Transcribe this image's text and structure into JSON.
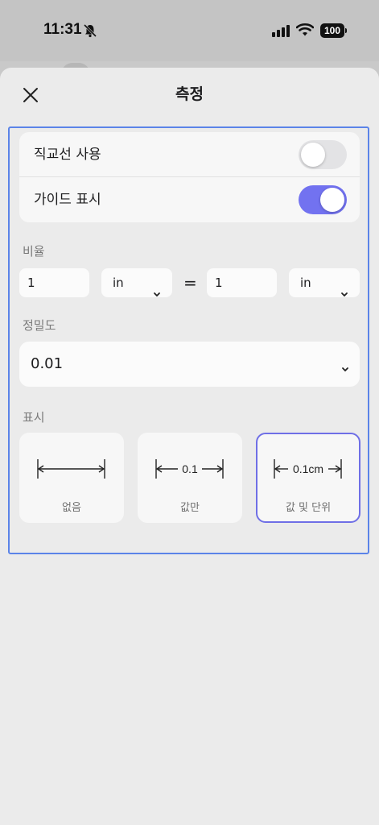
{
  "status_bar": {
    "time": "11:31",
    "battery": "100"
  },
  "sheet": {
    "title": "측정",
    "toggles": [
      {
        "label": "직교선 사용",
        "on": false
      },
      {
        "label": "가이드 표시",
        "on": true
      }
    ],
    "ratio": {
      "label": "비율",
      "left_value": "1",
      "left_unit": "in",
      "equals": "=",
      "right_value": "1",
      "right_unit": "in"
    },
    "precision": {
      "label": "정밀도",
      "value": "0.01"
    },
    "display": {
      "label": "표시",
      "options": [
        {
          "label": "없음",
          "sample": "",
          "selected": false
        },
        {
          "label": "값만",
          "sample": "0.1",
          "selected": false
        },
        {
          "label": "값 및 단위",
          "sample": "0.1cm",
          "selected": true
        }
      ]
    }
  },
  "colors": {
    "accent": "#7272f0",
    "focus_frame": "#5b84e8",
    "sheet_background": "#ebebeb"
  }
}
